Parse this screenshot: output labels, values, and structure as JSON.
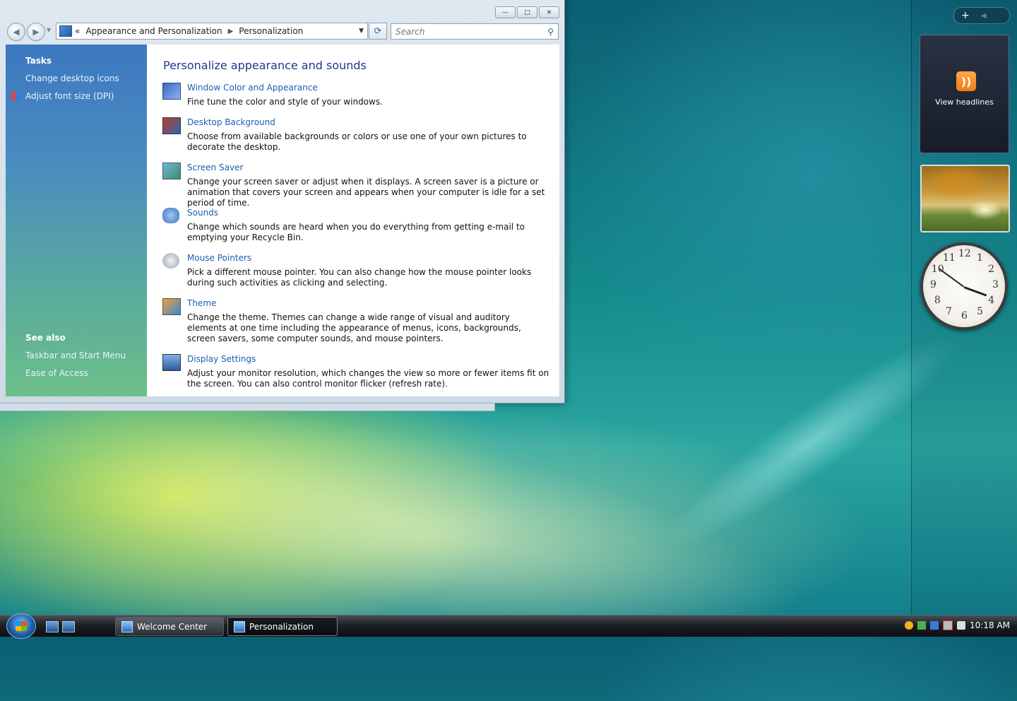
{
  "window": {
    "breadcrumb": [
      "Appearance and Personalization",
      "Personalization"
    ],
    "breadcrumb_prefix": "«",
    "search_placeholder": "Search",
    "controls": {
      "minimize": "—",
      "maximize": "□",
      "close": "✕"
    }
  },
  "left_pane": {
    "tasks_header": "Tasks",
    "tasks": [
      "Change desktop icons",
      "Adjust font size (DPI)"
    ],
    "see_also_header": "See also",
    "see_also": [
      "Taskbar and Start Menu",
      "Ease of Access"
    ]
  },
  "content": {
    "heading": "Personalize appearance and sounds",
    "items": [
      {
        "title": "Window Color and Appearance",
        "desc": "Fine tune the color and style of your windows.",
        "icon": "window-color-icon"
      },
      {
        "title": "Desktop Background",
        "desc": "Choose from available backgrounds or colors or use one of your own pictures to decorate the desktop.",
        "icon": "desktop-background-icon"
      },
      {
        "title": "Screen Saver",
        "desc": "Change your screen saver or adjust when it displays. A screen saver is a picture or animation that covers your screen and appears when your computer is idle for a set period of time.",
        "icon": "screen-saver-icon"
      },
      {
        "title": "Sounds",
        "desc": "Change which sounds are heard when you do everything from getting e-mail to emptying your Recycle Bin.",
        "icon": "sounds-icon"
      },
      {
        "title": "Mouse Pointers",
        "desc": "Pick a different mouse pointer. You can also change how the mouse pointer looks during such activities as clicking and selecting.",
        "icon": "mouse-pointer-icon"
      },
      {
        "title": "Theme",
        "desc": "Change the theme. Themes can change a wide range of visual and auditory elements at one time including the appearance of menus, icons, backgrounds, screen savers, some computer sounds, and mouse pointers.",
        "icon": "theme-icon"
      },
      {
        "title": "Display Settings",
        "desc": "Adjust your monitor resolution, which changes the view so more or fewer items fit on the screen. You can also control monitor flicker (refresh rate).",
        "icon": "display-settings-icon"
      }
    ]
  },
  "sidebar": {
    "add_label": "+",
    "feeds_label": "View headlines",
    "clock_numbers": [
      "12",
      "1",
      "2",
      "3",
      "4",
      "5",
      "6",
      "7",
      "8",
      "9",
      "10",
      "11"
    ]
  },
  "taskbar": {
    "tasks": [
      {
        "label": "Welcome Center",
        "active": false
      },
      {
        "label": "Personalization",
        "active": true
      }
    ],
    "time": "10:18 AM"
  }
}
